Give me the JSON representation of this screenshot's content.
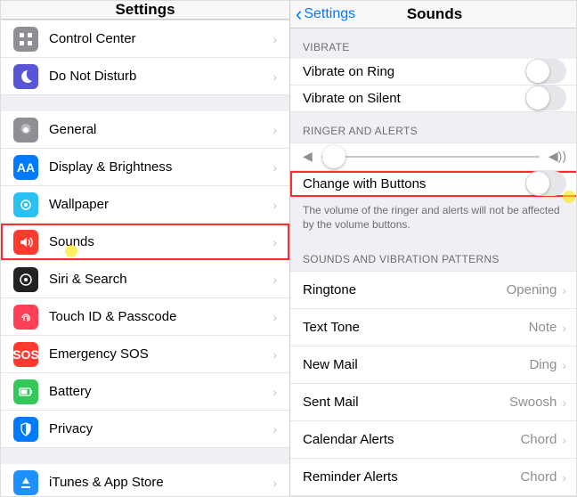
{
  "left": {
    "title": "Settings",
    "groups": [
      [
        {
          "label": "Control Center",
          "icon": "control-center-icon",
          "cls": "i-gray"
        },
        {
          "label": "Do Not Disturb",
          "icon": "moon-icon",
          "cls": "i-moon"
        }
      ],
      [
        {
          "label": "General",
          "icon": "gear-icon",
          "cls": "i-gray"
        },
        {
          "label": "Display & Brightness",
          "icon": "display-icon",
          "cls": "i-blueA",
          "txt": "AA"
        },
        {
          "label": "Wallpaper",
          "icon": "wallpaper-icon",
          "cls": "i-cyan"
        },
        {
          "label": "Sounds",
          "icon": "sounds-icon",
          "cls": "i-red",
          "highlight": true,
          "cursor": true
        },
        {
          "label": "Siri & Search",
          "icon": "siri-icon",
          "cls": "i-black"
        },
        {
          "label": "Touch ID & Passcode",
          "icon": "touchid-icon",
          "cls": "i-lock"
        },
        {
          "label": "Emergency SOS",
          "icon": "sos-icon",
          "cls": "i-sos",
          "txt": "SOS"
        },
        {
          "label": "Battery",
          "icon": "battery-icon",
          "cls": "i-green"
        },
        {
          "label": "Privacy",
          "icon": "privacy-icon",
          "cls": "i-blueA"
        }
      ],
      [
        {
          "label": "iTunes & App Store",
          "icon": "appstore-icon",
          "cls": "i-store"
        }
      ]
    ]
  },
  "right": {
    "back": "Settings",
    "title": "Sounds",
    "vibrate_header": "VIBRATE",
    "vibrate_ring": "Vibrate on Ring",
    "vibrate_silent": "Vibrate on Silent",
    "ringer_header": "RINGER AND ALERTS",
    "change_buttons": "Change with Buttons",
    "change_footer": "The volume of the ringer and alerts will not be affected by the volume buttons.",
    "patterns_header": "SOUNDS AND VIBRATION PATTERNS",
    "patterns": [
      {
        "label": "Ringtone",
        "value": "Opening"
      },
      {
        "label": "Text Tone",
        "value": "Note"
      },
      {
        "label": "New Mail",
        "value": "Ding"
      },
      {
        "label": "Sent Mail",
        "value": "Swoosh"
      },
      {
        "label": "Calendar Alerts",
        "value": "Chord"
      },
      {
        "label": "Reminder Alerts",
        "value": "Chord"
      }
    ]
  }
}
